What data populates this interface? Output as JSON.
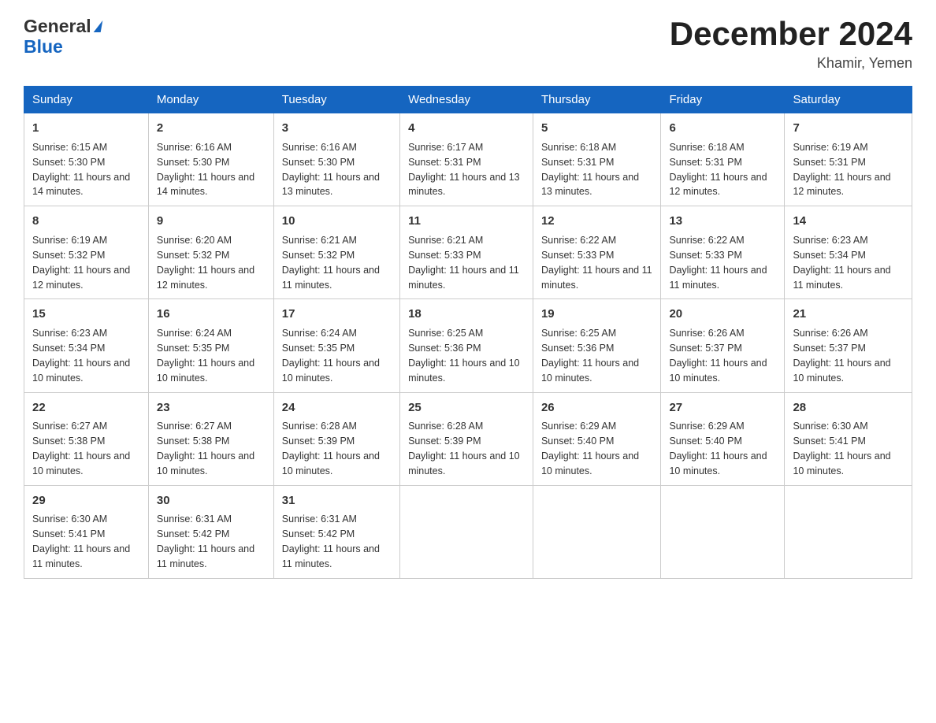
{
  "logo": {
    "general": "General",
    "blue": "Blue"
  },
  "title": "December 2024",
  "location": "Khamir, Yemen",
  "days_of_week": [
    "Sunday",
    "Monday",
    "Tuesday",
    "Wednesday",
    "Thursday",
    "Friday",
    "Saturday"
  ],
  "weeks": [
    [
      {
        "day": "1",
        "sunrise": "6:15 AM",
        "sunset": "5:30 PM",
        "daylight": "11 hours and 14 minutes."
      },
      {
        "day": "2",
        "sunrise": "6:16 AM",
        "sunset": "5:30 PM",
        "daylight": "11 hours and 14 minutes."
      },
      {
        "day": "3",
        "sunrise": "6:16 AM",
        "sunset": "5:30 PM",
        "daylight": "11 hours and 13 minutes."
      },
      {
        "day": "4",
        "sunrise": "6:17 AM",
        "sunset": "5:31 PM",
        "daylight": "11 hours and 13 minutes."
      },
      {
        "day": "5",
        "sunrise": "6:18 AM",
        "sunset": "5:31 PM",
        "daylight": "11 hours and 13 minutes."
      },
      {
        "day": "6",
        "sunrise": "6:18 AM",
        "sunset": "5:31 PM",
        "daylight": "11 hours and 12 minutes."
      },
      {
        "day": "7",
        "sunrise": "6:19 AM",
        "sunset": "5:31 PM",
        "daylight": "11 hours and 12 minutes."
      }
    ],
    [
      {
        "day": "8",
        "sunrise": "6:19 AM",
        "sunset": "5:32 PM",
        "daylight": "11 hours and 12 minutes."
      },
      {
        "day": "9",
        "sunrise": "6:20 AM",
        "sunset": "5:32 PM",
        "daylight": "11 hours and 12 minutes."
      },
      {
        "day": "10",
        "sunrise": "6:21 AM",
        "sunset": "5:32 PM",
        "daylight": "11 hours and 11 minutes."
      },
      {
        "day": "11",
        "sunrise": "6:21 AM",
        "sunset": "5:33 PM",
        "daylight": "11 hours and 11 minutes."
      },
      {
        "day": "12",
        "sunrise": "6:22 AM",
        "sunset": "5:33 PM",
        "daylight": "11 hours and 11 minutes."
      },
      {
        "day": "13",
        "sunrise": "6:22 AM",
        "sunset": "5:33 PM",
        "daylight": "11 hours and 11 minutes."
      },
      {
        "day": "14",
        "sunrise": "6:23 AM",
        "sunset": "5:34 PM",
        "daylight": "11 hours and 11 minutes."
      }
    ],
    [
      {
        "day": "15",
        "sunrise": "6:23 AM",
        "sunset": "5:34 PM",
        "daylight": "11 hours and 10 minutes."
      },
      {
        "day": "16",
        "sunrise": "6:24 AM",
        "sunset": "5:35 PM",
        "daylight": "11 hours and 10 minutes."
      },
      {
        "day": "17",
        "sunrise": "6:24 AM",
        "sunset": "5:35 PM",
        "daylight": "11 hours and 10 minutes."
      },
      {
        "day": "18",
        "sunrise": "6:25 AM",
        "sunset": "5:36 PM",
        "daylight": "11 hours and 10 minutes."
      },
      {
        "day": "19",
        "sunrise": "6:25 AM",
        "sunset": "5:36 PM",
        "daylight": "11 hours and 10 minutes."
      },
      {
        "day": "20",
        "sunrise": "6:26 AM",
        "sunset": "5:37 PM",
        "daylight": "11 hours and 10 minutes."
      },
      {
        "day": "21",
        "sunrise": "6:26 AM",
        "sunset": "5:37 PM",
        "daylight": "11 hours and 10 minutes."
      }
    ],
    [
      {
        "day": "22",
        "sunrise": "6:27 AM",
        "sunset": "5:38 PM",
        "daylight": "11 hours and 10 minutes."
      },
      {
        "day": "23",
        "sunrise": "6:27 AM",
        "sunset": "5:38 PM",
        "daylight": "11 hours and 10 minutes."
      },
      {
        "day": "24",
        "sunrise": "6:28 AM",
        "sunset": "5:39 PM",
        "daylight": "11 hours and 10 minutes."
      },
      {
        "day": "25",
        "sunrise": "6:28 AM",
        "sunset": "5:39 PM",
        "daylight": "11 hours and 10 minutes."
      },
      {
        "day": "26",
        "sunrise": "6:29 AM",
        "sunset": "5:40 PM",
        "daylight": "11 hours and 10 minutes."
      },
      {
        "day": "27",
        "sunrise": "6:29 AM",
        "sunset": "5:40 PM",
        "daylight": "11 hours and 10 minutes."
      },
      {
        "day": "28",
        "sunrise": "6:30 AM",
        "sunset": "5:41 PM",
        "daylight": "11 hours and 10 minutes."
      }
    ],
    [
      {
        "day": "29",
        "sunrise": "6:30 AM",
        "sunset": "5:41 PM",
        "daylight": "11 hours and 11 minutes."
      },
      {
        "day": "30",
        "sunrise": "6:31 AM",
        "sunset": "5:42 PM",
        "daylight": "11 hours and 11 minutes."
      },
      {
        "day": "31",
        "sunrise": "6:31 AM",
        "sunset": "5:42 PM",
        "daylight": "11 hours and 11 minutes."
      },
      null,
      null,
      null,
      null
    ]
  ],
  "labels": {
    "sunrise": "Sunrise:",
    "sunset": "Sunset:",
    "daylight": "Daylight:"
  }
}
